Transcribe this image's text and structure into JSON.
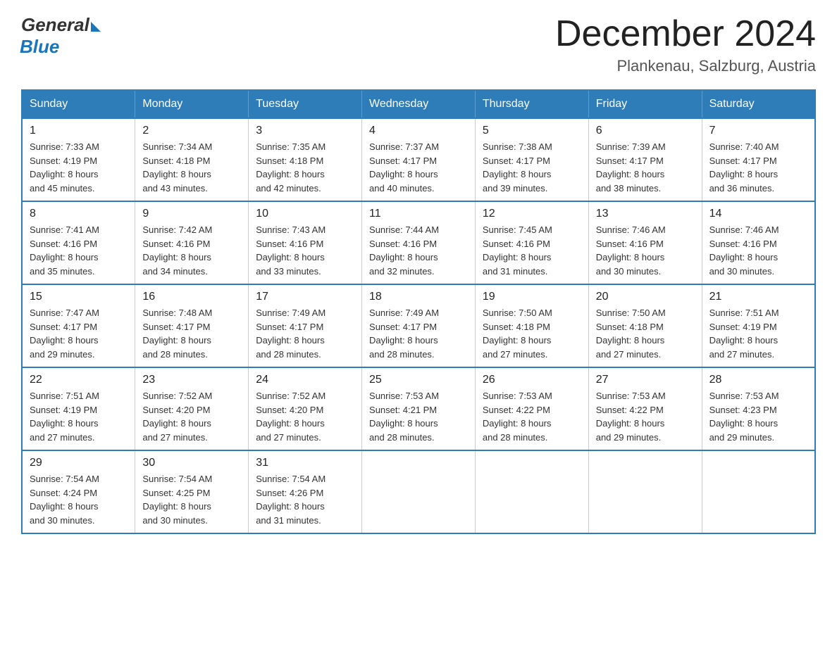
{
  "logo": {
    "general_text": "General",
    "blue_text": "Blue"
  },
  "title": "December 2024",
  "location": "Plankenau, Salzburg, Austria",
  "days_of_week": [
    "Sunday",
    "Monday",
    "Tuesday",
    "Wednesday",
    "Thursday",
    "Friday",
    "Saturday"
  ],
  "weeks": [
    [
      {
        "day": "1",
        "sunrise": "7:33 AM",
        "sunset": "4:19 PM",
        "daylight": "8 hours and 45 minutes."
      },
      {
        "day": "2",
        "sunrise": "7:34 AM",
        "sunset": "4:18 PM",
        "daylight": "8 hours and 43 minutes."
      },
      {
        "day": "3",
        "sunrise": "7:35 AM",
        "sunset": "4:18 PM",
        "daylight": "8 hours and 42 minutes."
      },
      {
        "day": "4",
        "sunrise": "7:37 AM",
        "sunset": "4:17 PM",
        "daylight": "8 hours and 40 minutes."
      },
      {
        "day": "5",
        "sunrise": "7:38 AM",
        "sunset": "4:17 PM",
        "daylight": "8 hours and 39 minutes."
      },
      {
        "day": "6",
        "sunrise": "7:39 AM",
        "sunset": "4:17 PM",
        "daylight": "8 hours and 38 minutes."
      },
      {
        "day": "7",
        "sunrise": "7:40 AM",
        "sunset": "4:17 PM",
        "daylight": "8 hours and 36 minutes."
      }
    ],
    [
      {
        "day": "8",
        "sunrise": "7:41 AM",
        "sunset": "4:16 PM",
        "daylight": "8 hours and 35 minutes."
      },
      {
        "day": "9",
        "sunrise": "7:42 AM",
        "sunset": "4:16 PM",
        "daylight": "8 hours and 34 minutes."
      },
      {
        "day": "10",
        "sunrise": "7:43 AM",
        "sunset": "4:16 PM",
        "daylight": "8 hours and 33 minutes."
      },
      {
        "day": "11",
        "sunrise": "7:44 AM",
        "sunset": "4:16 PM",
        "daylight": "8 hours and 32 minutes."
      },
      {
        "day": "12",
        "sunrise": "7:45 AM",
        "sunset": "4:16 PM",
        "daylight": "8 hours and 31 minutes."
      },
      {
        "day": "13",
        "sunrise": "7:46 AM",
        "sunset": "4:16 PM",
        "daylight": "8 hours and 30 minutes."
      },
      {
        "day": "14",
        "sunrise": "7:46 AM",
        "sunset": "4:16 PM",
        "daylight": "8 hours and 30 minutes."
      }
    ],
    [
      {
        "day": "15",
        "sunrise": "7:47 AM",
        "sunset": "4:17 PM",
        "daylight": "8 hours and 29 minutes."
      },
      {
        "day": "16",
        "sunrise": "7:48 AM",
        "sunset": "4:17 PM",
        "daylight": "8 hours and 28 minutes."
      },
      {
        "day": "17",
        "sunrise": "7:49 AM",
        "sunset": "4:17 PM",
        "daylight": "8 hours and 28 minutes."
      },
      {
        "day": "18",
        "sunrise": "7:49 AM",
        "sunset": "4:17 PM",
        "daylight": "8 hours and 28 minutes."
      },
      {
        "day": "19",
        "sunrise": "7:50 AM",
        "sunset": "4:18 PM",
        "daylight": "8 hours and 27 minutes."
      },
      {
        "day": "20",
        "sunrise": "7:50 AM",
        "sunset": "4:18 PM",
        "daylight": "8 hours and 27 minutes."
      },
      {
        "day": "21",
        "sunrise": "7:51 AM",
        "sunset": "4:19 PM",
        "daylight": "8 hours and 27 minutes."
      }
    ],
    [
      {
        "day": "22",
        "sunrise": "7:51 AM",
        "sunset": "4:19 PM",
        "daylight": "8 hours and 27 minutes."
      },
      {
        "day": "23",
        "sunrise": "7:52 AM",
        "sunset": "4:20 PM",
        "daylight": "8 hours and 27 minutes."
      },
      {
        "day": "24",
        "sunrise": "7:52 AM",
        "sunset": "4:20 PM",
        "daylight": "8 hours and 27 minutes."
      },
      {
        "day": "25",
        "sunrise": "7:53 AM",
        "sunset": "4:21 PM",
        "daylight": "8 hours and 28 minutes."
      },
      {
        "day": "26",
        "sunrise": "7:53 AM",
        "sunset": "4:22 PM",
        "daylight": "8 hours and 28 minutes."
      },
      {
        "day": "27",
        "sunrise": "7:53 AM",
        "sunset": "4:22 PM",
        "daylight": "8 hours and 29 minutes."
      },
      {
        "day": "28",
        "sunrise": "7:53 AM",
        "sunset": "4:23 PM",
        "daylight": "8 hours and 29 minutes."
      }
    ],
    [
      {
        "day": "29",
        "sunrise": "7:54 AM",
        "sunset": "4:24 PM",
        "daylight": "8 hours and 30 minutes."
      },
      {
        "day": "30",
        "sunrise": "7:54 AM",
        "sunset": "4:25 PM",
        "daylight": "8 hours and 30 minutes."
      },
      {
        "day": "31",
        "sunrise": "7:54 AM",
        "sunset": "4:26 PM",
        "daylight": "8 hours and 31 minutes."
      },
      null,
      null,
      null,
      null
    ]
  ],
  "labels": {
    "sunrise": "Sunrise:",
    "sunset": "Sunset:",
    "daylight": "Daylight:"
  }
}
